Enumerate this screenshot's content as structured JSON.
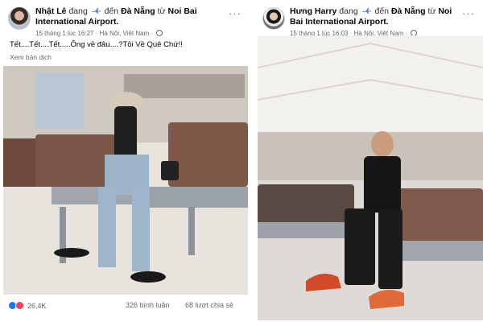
{
  "left_post": {
    "author": "Nhật Lê",
    "verb": "đang",
    "action_prefix": "đến",
    "destination": "Đà Nẵng",
    "from_word": "từ",
    "origin": "Noi Bai International Airport.",
    "timestamp": "15 tháng 1 lúc 16:27 · Hà Nội, Việt Nam ·",
    "text": "Tết....Tết....Tết.....Ông về đâu....?Tôi Về Quê Chứ!!",
    "translate": "Xem bản dịch",
    "reactions_count": "26,4K",
    "comments": "326 bình luận",
    "shares": "68 lượt chia sẻ",
    "more_icon": "···"
  },
  "right_post": {
    "author": "Hưng Harry",
    "verb": "đang",
    "action_prefix": "đến",
    "destination": "Đà Nẵng",
    "from_word": "từ",
    "origin": "Noi Bai International Airport.",
    "timestamp": "15 tháng 1 lúc 16:03 · Hà Nội, Việt Nam ·",
    "more_icon": "···"
  },
  "colors": {
    "facebook_blue": "#1877f2",
    "love_red": "#f33e58",
    "meta_gray": "#65676b"
  }
}
